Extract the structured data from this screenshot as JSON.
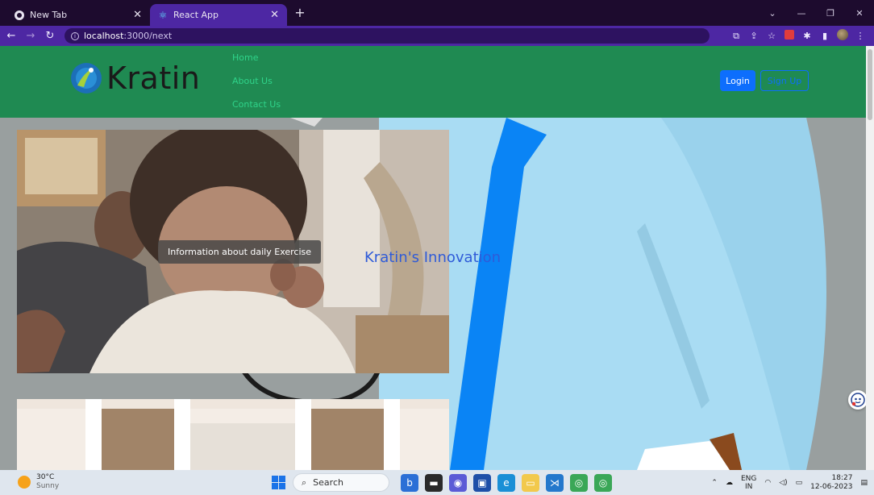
{
  "browser": {
    "tabs": [
      {
        "title": "New Tab",
        "icon": "chrome-icon",
        "active": false
      },
      {
        "title": "React App",
        "icon": "react-icon",
        "active": true
      }
    ],
    "url_host": "localhost",
    "url_path": ":3000/next",
    "accent_color": "#4d27a3"
  },
  "navbar": {
    "brand": "Kratin",
    "links": [
      "Home",
      "About Us",
      "Contact Us"
    ],
    "login_label": "Login",
    "signup_label": "Sign Up",
    "bg_color": "#1f8a52"
  },
  "hero": {
    "caption": "Information about daily Exercise",
    "overlay_text": "Kratin's Innovation"
  },
  "taskbar": {
    "temperature": "30°C",
    "condition": "Sunny",
    "search_placeholder": "Search",
    "lang_top": "ENG",
    "lang_bottom": "IN",
    "time": "18:27",
    "date": "12-06-2023"
  }
}
